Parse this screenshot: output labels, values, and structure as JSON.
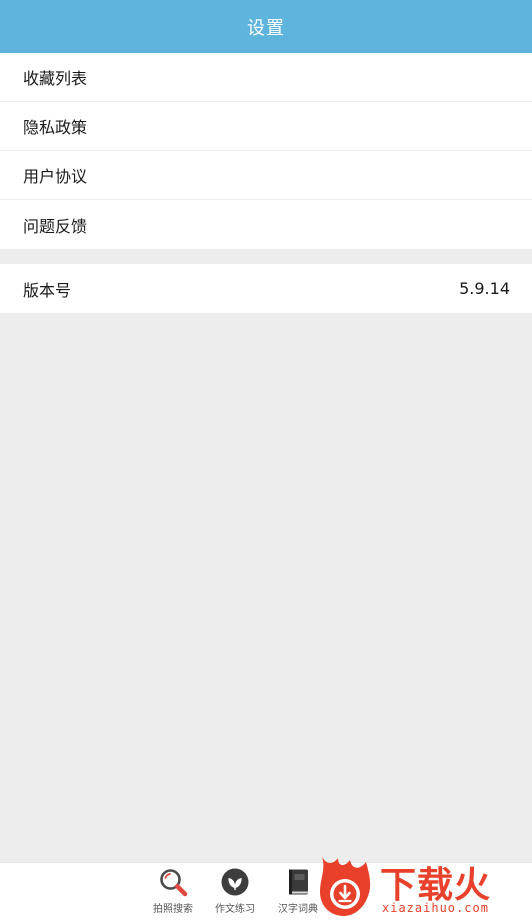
{
  "header": {
    "title": "设置"
  },
  "settings_group_1": [
    {
      "label": "收藏列表"
    },
    {
      "label": "隐私政策"
    },
    {
      "label": "用户协议"
    },
    {
      "label": "问题反馈"
    }
  ],
  "settings_group_2": [
    {
      "label": "版本号",
      "value": "5.9.14"
    }
  ],
  "tabbar": {
    "tabs": [
      {
        "label": "拍照搜索",
        "icon": "magnifier-icon"
      },
      {
        "label": "作文练习",
        "icon": "leaf-icon"
      },
      {
        "label": "汉字词典",
        "icon": "book-icon"
      }
    ]
  },
  "watermark": {
    "brand": "下载火",
    "domain": "xiazaihuo.com",
    "color": "#e8402a"
  },
  "colors": {
    "header": "#5fb4de",
    "background": "#ededed"
  }
}
